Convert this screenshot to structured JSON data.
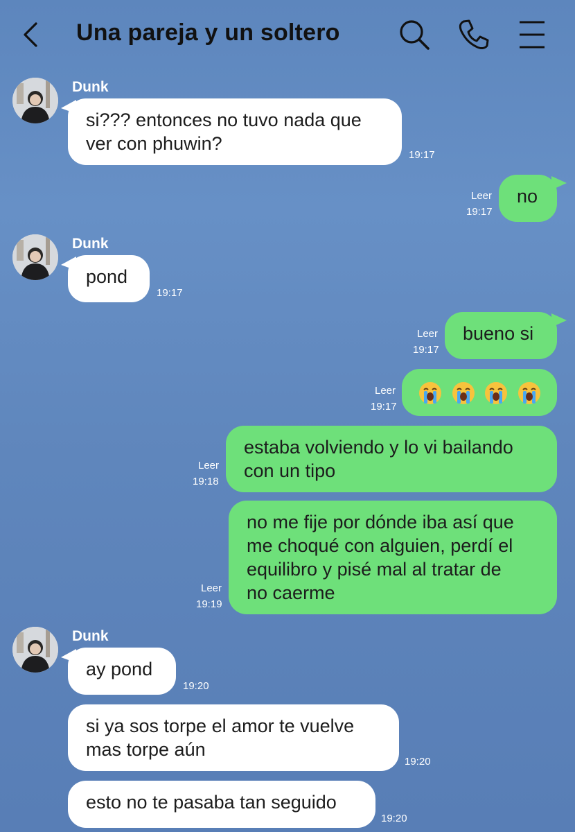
{
  "header": {
    "title": "Una pareja y un soltero",
    "icons": [
      "back-chevron-icon",
      "search-icon",
      "phone-icon",
      "menu-icon"
    ]
  },
  "colors": {
    "background": "#6089bf",
    "incoming": "#ffffff",
    "outgoing": "#6ee07a"
  },
  "messages": [
    {
      "side": "in",
      "sender": "Dunk",
      "text": "si??? entonces no tuvo nada que\nver con phuwin?",
      "time": "19:17"
    },
    {
      "side": "out",
      "read": "Leer",
      "text": "no",
      "time": "19:17"
    },
    {
      "side": "in",
      "sender": "Dunk",
      "text": "pond",
      "time": "19:17"
    },
    {
      "side": "out",
      "read": "Leer",
      "text": "bueno si",
      "time": "19:17"
    },
    {
      "side": "out",
      "read": "Leer",
      "text": "😭😭😭😭",
      "time": "19:17"
    },
    {
      "side": "out",
      "read": "Leer",
      "text": "estaba volviendo y lo vi bailando\ncon un tipo",
      "time": "19:18"
    },
    {
      "side": "out",
      "read": "Leer",
      "text": "no me fije por dónde iba así que\nme choqué con alguien, perdí el\nequilibro y pisé mal al tratar de\nno caerme",
      "time": "19:19"
    },
    {
      "side": "in",
      "sender": "Dunk",
      "text": "ay pond",
      "time": "19:20"
    },
    {
      "side": "in",
      "text": "si ya sos torpe el amor te vuelve\nmas torpe aún",
      "time": "19:20"
    },
    {
      "side": "in",
      "text": "esto no te pasaba tan seguido",
      "time": "19:20"
    }
  ]
}
